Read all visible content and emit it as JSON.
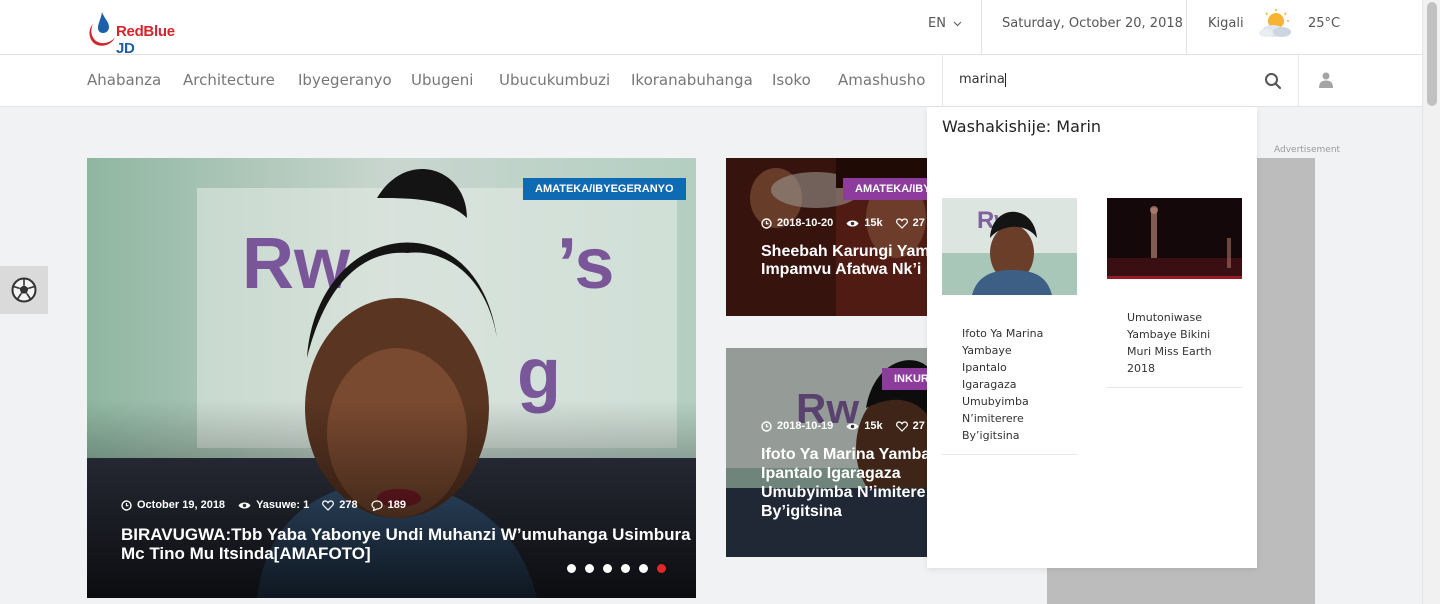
{
  "header": {
    "logo_text": "RedBlue JD",
    "language": "EN",
    "date": "Saturday, October 20, 2018",
    "city": "Kigali",
    "temperature": "25°C",
    "weather_icon": "partly-cloudy-icon"
  },
  "nav": {
    "items": [
      "Ahabanza",
      "Architecture",
      "Ibyegeranyo",
      "Ubugeni",
      "Ubucukumbuzi",
      "Ikoranabuhanga",
      "Isoko",
      "Amashusho"
    ]
  },
  "search": {
    "value": "marina",
    "results_heading": "Washakishije: Marin",
    "results": [
      {
        "title": "Ifoto Ya Marina Yambaye Ipantalo Igaragaza Umubyimba N’imiterere By’igitsina"
      },
      {
        "title": "Umutoniwase Yambaye Bikini Muri Miss Earth 2018"
      }
    ]
  },
  "hero": {
    "category": "AMATEKA/IBYEGERANYO",
    "category_color": "#0f6ab4",
    "date": "October 19, 2018",
    "author": "Yasuwe: 1",
    "likes": "278",
    "comments": "189",
    "title_line1": "BIRAVUGWA:Tbb Yaba Yabonye Undi Muhanzi W’umuhanga Usimbura",
    "title_line2": "Mc Tino Mu Itsinda[AMAFOTO]",
    "slides": 6,
    "active_slide": 6
  },
  "side_cards": [
    {
      "category": "AMATEKA/IBY",
      "category_color": "#8e3b9e",
      "date": "2018-10-20",
      "views": "15k",
      "likes": "27",
      "title_line1": "Sheebah Karungi Yam",
      "title_line2": "Impamvu Afatwa Nk’i"
    },
    {
      "category": "INKUR",
      "category_color": "#8e3b9e",
      "date": "2018-10-19",
      "views": "15k",
      "likes": "27",
      "title_line1": "Ifoto Ya Marina Yamba",
      "title_line2": "Ipantalo Igaragaza",
      "title_line3": "Umubyimba N’imitere",
      "title_line4": "By’igitsina"
    }
  ],
  "advertisement": {
    "label": "Advertisement"
  }
}
